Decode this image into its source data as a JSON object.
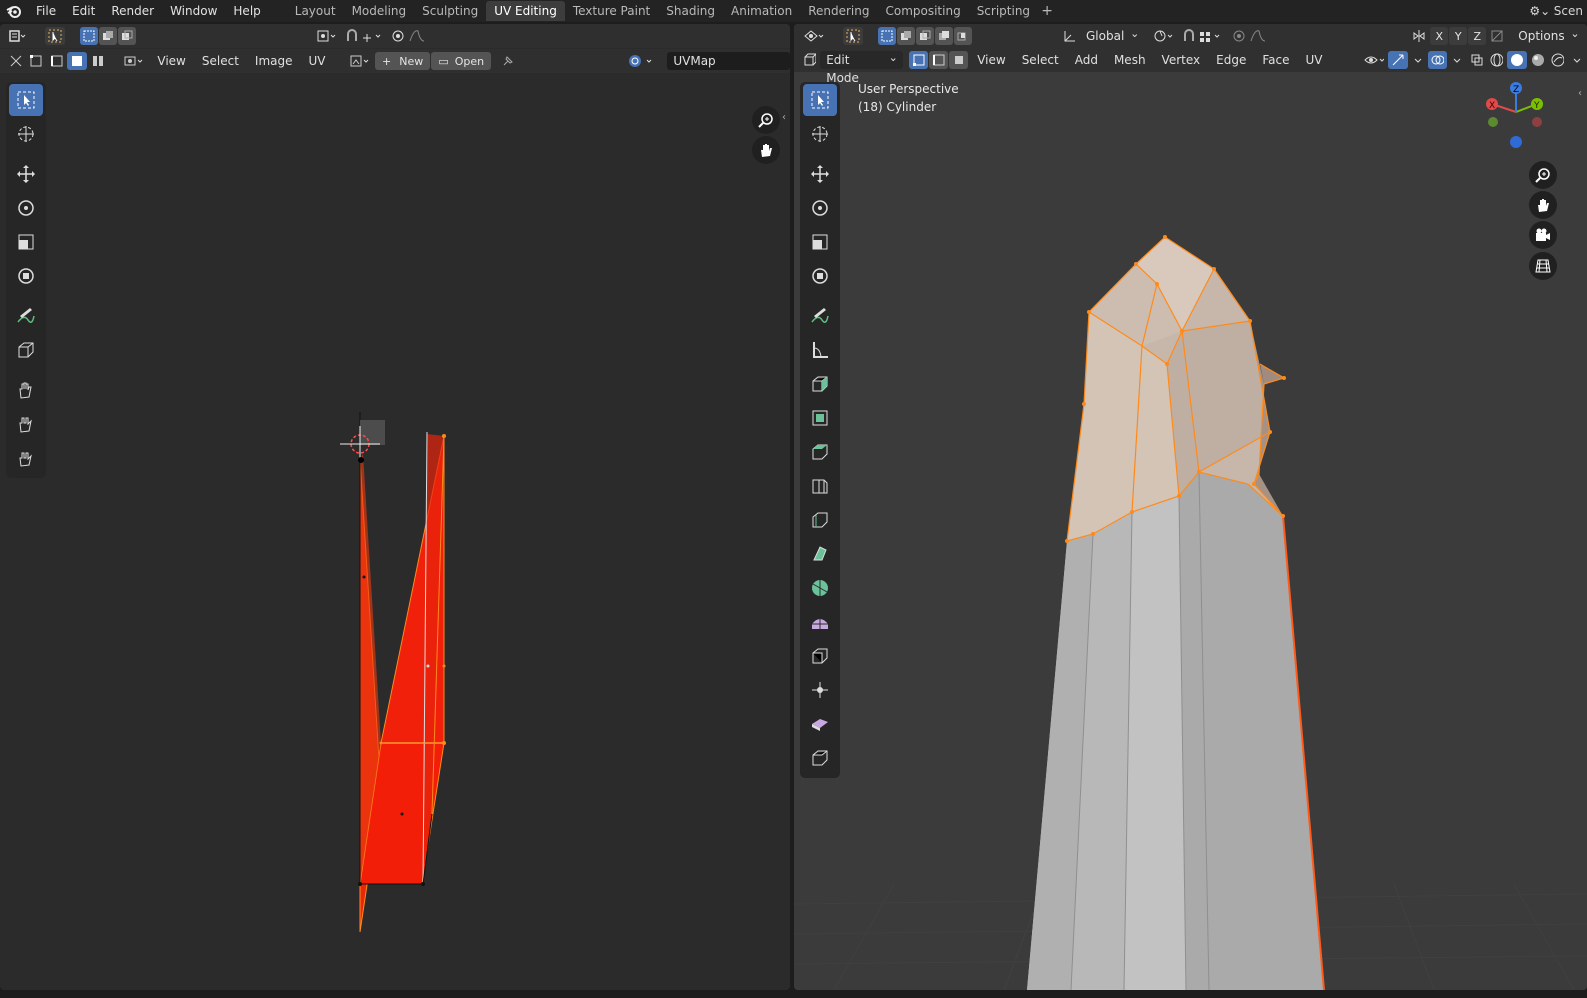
{
  "topbar": {
    "menus": [
      "File",
      "Edit",
      "Render",
      "Window",
      "Help"
    ],
    "tabs": [
      "Layout",
      "Modeling",
      "Sculpting",
      "UV Editing",
      "Texture Paint",
      "Shading",
      "Animation",
      "Rendering",
      "Compositing",
      "Scripting"
    ],
    "active_tab": "UV Editing",
    "scene_label": "Scen"
  },
  "uv_editor": {
    "menus": [
      "View",
      "Select",
      "Image",
      "UV"
    ],
    "new_label": "New",
    "open_label": "Open",
    "uvmap_value": "UVMap"
  },
  "viewport": {
    "mode": "Edit Mode",
    "menus": [
      "View",
      "Select",
      "Add",
      "Mesh",
      "Vertex",
      "Edge",
      "Face",
      "UV"
    ],
    "transform_orientation": "Global",
    "options_label": "Options",
    "axis_buttons": [
      "X",
      "Y",
      "Z"
    ],
    "perspective_label": "User Perspective",
    "object_label": "(18) Cylinder",
    "gizmo_labels": {
      "x": "X",
      "y": "Y",
      "z": "Z"
    }
  },
  "colors": {
    "accent": "#4772b3",
    "selected_face": "#e8220a",
    "selected_edge": "#ff8a1a",
    "mesh_gray": "#bdbdbd"
  }
}
